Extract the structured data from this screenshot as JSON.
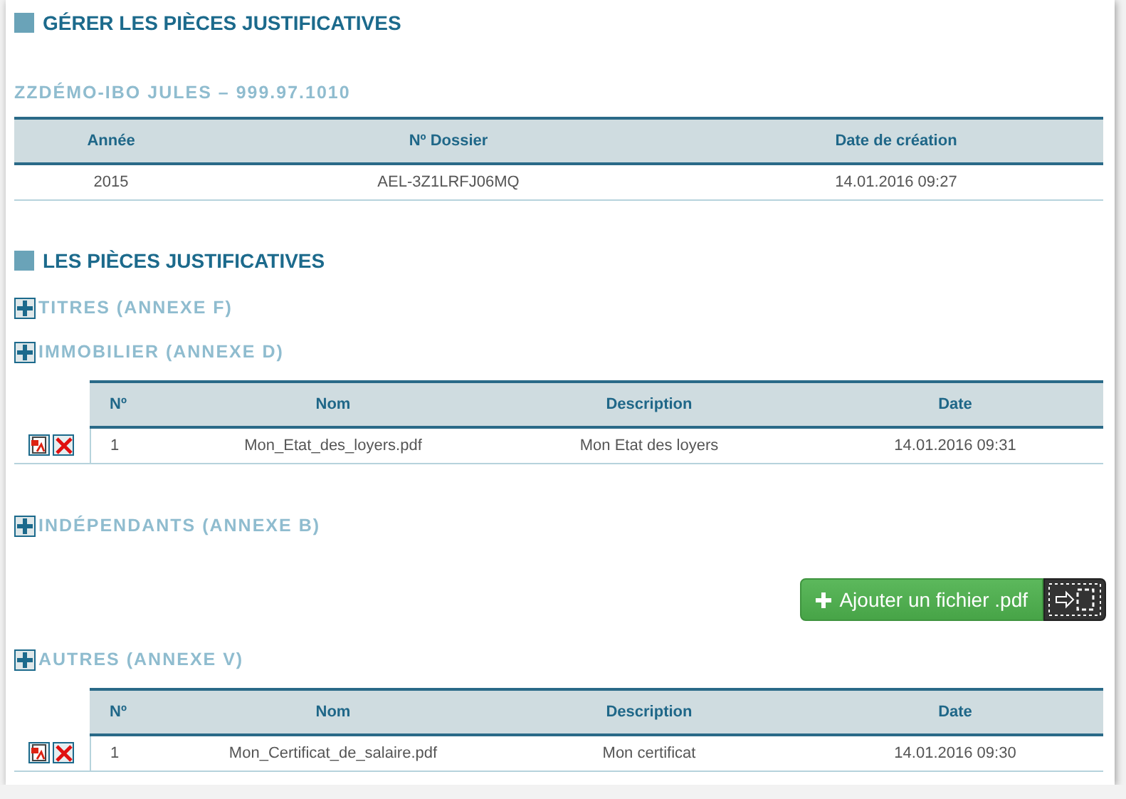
{
  "title": "GÉRER LES PIÈCES JUSTIFICATIVES",
  "taxpayer": "ZZDÉMO-IBO JULES – 999.97.1010",
  "dossier_table": {
    "columns": [
      "Année",
      "Nº Dossier",
      "Date de création"
    ],
    "rows": [
      [
        "2015",
        "AEL-3Z1LRFJ06MQ",
        "14.01.2016 09:27"
      ]
    ]
  },
  "documents_title": "LES PIÈCES JUSTIFICATIVES",
  "categories": [
    {
      "label": "TITRES (ANNEXE F)"
    },
    {
      "label": "IMMOBILIER (ANNEXE D)",
      "columns": [
        "Nº",
        "Nom",
        "Description",
        "Date"
      ],
      "rows": [
        [
          "1",
          "Mon_Etat_des_loyers.pdf",
          "Mon Etat des loyers",
          "14.01.2016 09:31"
        ]
      ]
    },
    {
      "label": "INDÉPENDANTS (ANNEXE B)",
      "upload_button": "Ajouter un fichier .pdf"
    },
    {
      "label": "AUTRES (ANNEXE V)",
      "columns": [
        "Nº",
        "Nom",
        "Description",
        "Date"
      ],
      "rows": [
        [
          "1",
          "Mon_Certificat_de_salaire.pdf",
          "Mon certificat",
          "14.01.2016 09:30"
        ]
      ]
    }
  ]
}
